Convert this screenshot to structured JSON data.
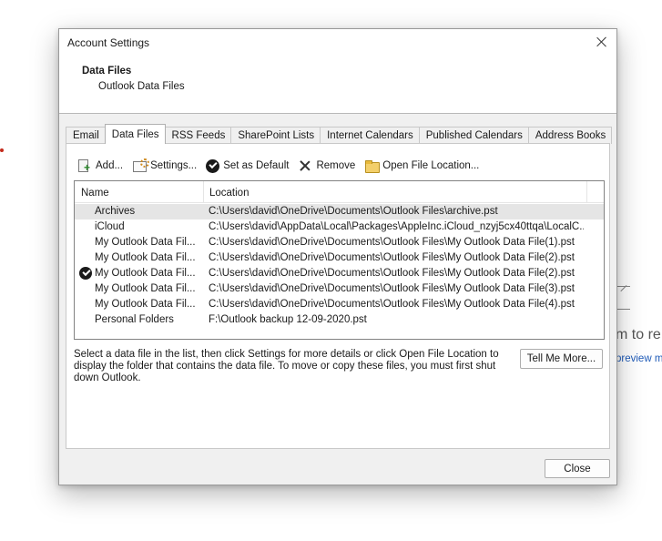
{
  "background": {
    "partial_text": "m to re",
    "partial_link": "preview m"
  },
  "dialog": {
    "title": "Account Settings",
    "header": {
      "title": "Data Files",
      "subtitle": "Outlook Data Files"
    },
    "tabs": [
      {
        "label": "Email",
        "active": false
      },
      {
        "label": "Data Files",
        "active": true
      },
      {
        "label": "RSS Feeds",
        "active": false
      },
      {
        "label": "SharePoint Lists",
        "active": false
      },
      {
        "label": "Internet Calendars",
        "active": false
      },
      {
        "label": "Published Calendars",
        "active": false
      },
      {
        "label": "Address Books",
        "active": false
      }
    ],
    "toolbar": {
      "add_label": "Add...",
      "settings_label": "Settings...",
      "set_default_label": "Set as Default",
      "remove_label": "Remove",
      "open_location_label": "Open File Location..."
    },
    "list": {
      "columns": {
        "name": "Name",
        "location": "Location"
      },
      "rows": [
        {
          "name": "Archives",
          "location": "C:\\Users\\david\\OneDrive\\Documents\\Outlook Files\\archive.pst",
          "selected": true,
          "default": false
        },
        {
          "name": "iCloud",
          "location": "C:\\Users\\david\\AppData\\Local\\Packages\\AppleInc.iCloud_nzyj5cx40ttqa\\LocalC...",
          "selected": false,
          "default": false
        },
        {
          "name": "My Outlook Data Fil...",
          "location": "C:\\Users\\david\\OneDrive\\Documents\\Outlook Files\\My Outlook Data File(1).pst",
          "selected": false,
          "default": false
        },
        {
          "name": "My Outlook Data Fil...",
          "location": "C:\\Users\\david\\OneDrive\\Documents\\Outlook Files\\My Outlook Data File(2).pst",
          "selected": false,
          "default": false
        },
        {
          "name": "My Outlook Data Fil...",
          "location": "C:\\Users\\david\\OneDrive\\Documents\\Outlook Files\\My Outlook Data File(2).pst",
          "selected": false,
          "default": true
        },
        {
          "name": "My Outlook Data Fil...",
          "location": "C:\\Users\\david\\OneDrive\\Documents\\Outlook Files\\My Outlook Data File(3).pst",
          "selected": false,
          "default": false
        },
        {
          "name": "My Outlook Data Fil...",
          "location": "C:\\Users\\david\\OneDrive\\Documents\\Outlook Files\\My Outlook Data File(4).pst",
          "selected": false,
          "default": false
        },
        {
          "name": "Personal Folders",
          "location": "F:\\Outlook backup 12-09-2020.pst",
          "selected": false,
          "default": false
        }
      ]
    },
    "description": "Select a data file in the list, then click Settings for more details or click Open File Location to display the folder that contains the data file. To move or copy these files, you must first shut down Outlook.",
    "tell_me_more_label": "Tell Me More...",
    "close_label": "Close"
  }
}
